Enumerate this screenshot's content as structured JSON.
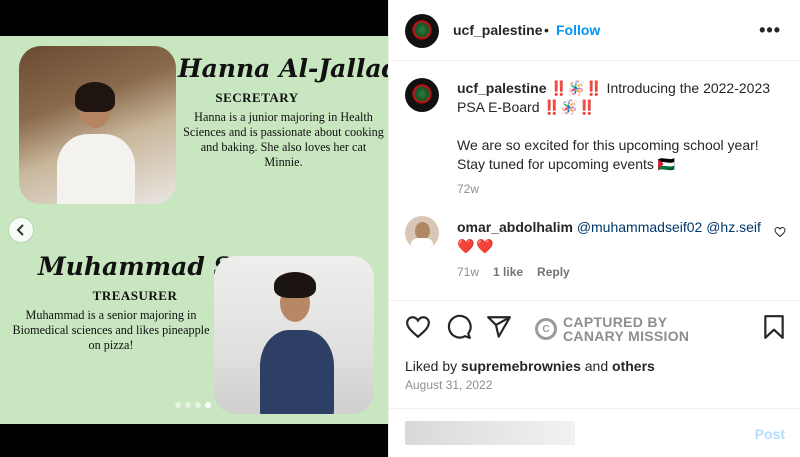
{
  "post": {
    "slide": {
      "member1": {
        "name": "Hanna Al-Jallad",
        "role": "SECRETARY",
        "bio": "Hanna is a junior majoring in Health Sciences and is passionate about cooking and baking. She also loves her cat Minnie."
      },
      "member2": {
        "name": "Muhammad Seif",
        "role": "TREASURER",
        "bio": "Muhammad is a senior majoring in Biomedical sciences and likes pineapple on pizza!"
      },
      "carousel_prev_icon": "chevron-left-icon",
      "slide_count": 4,
      "active_slide": 4
    }
  },
  "header": {
    "username": "ucf_palestine",
    "separator": "•",
    "follow_label": "Follow",
    "more_icon": "more-horizontal-icon"
  },
  "caption": {
    "username": "ucf_palestine",
    "line1": "‼️🪅‼️ Introducing the 2022-2023 PSA E-Board ‼️🪅‼️",
    "line2": "We are so excited for this upcoming school year! Stay tuned for upcoming events 🇵🇸",
    "time": "72w"
  },
  "comment": {
    "username": "omar_abdolhalim",
    "mentions": "@muhammadseif02 @hz.seif",
    "hearts": "❤️❤️",
    "time": "71w",
    "likes": "1 like",
    "reply_label": "Reply"
  },
  "actions": {
    "watermark_line1": "CAPTURED BY",
    "watermark_line2": "CANARY MISSION",
    "liked_by_prefix": "Liked by",
    "liked_by_user": "supremebrownies",
    "liked_by_suffix": "and",
    "liked_by_others": "others",
    "date": "August 31, 2022"
  },
  "add_comment": {
    "post_label": "Post"
  },
  "colors": {
    "slide_bg": "#c8e6c0",
    "link_blue": "#0095f6",
    "heart_red": "#ed4956"
  }
}
